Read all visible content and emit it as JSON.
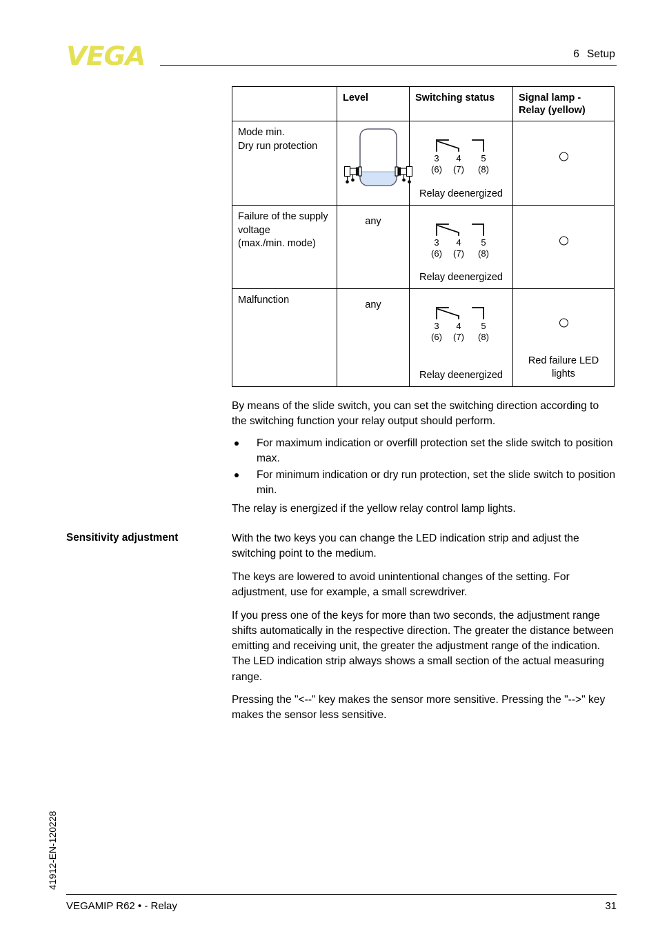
{
  "header": {
    "logo_text": "VEGA",
    "chapter_number": "6",
    "chapter_title": "Setup"
  },
  "table": {
    "columns": [
      "",
      "Level",
      "Switching status",
      "Signal lamp - Relay (yellow)"
    ],
    "rows": [
      {
        "condition_line1": "Mode min.",
        "condition_line2": "Dry run protection",
        "level": "",
        "level_graphic": "tank-low-level",
        "terminals_top": [
          "3",
          "4",
          "5"
        ],
        "terminals_bottom": [
          "(6)",
          "(7)",
          "(8)"
        ],
        "relay_state": "Relay deenergized",
        "lamp": "lamp-off-circle",
        "lamp_note": ""
      },
      {
        "condition_line1": "Failure of the supply",
        "condition_line2": "voltage",
        "condition_line3": "(max./min. mode)",
        "level": "any",
        "terminals_top": [
          "3",
          "4",
          "5"
        ],
        "terminals_bottom": [
          "(6)",
          "(7)",
          "(8)"
        ],
        "relay_state": "Relay deenergized",
        "lamp": "lamp-off-circle",
        "lamp_note": ""
      },
      {
        "condition_line1": "Malfunction",
        "level": "any",
        "terminals_top": [
          "3",
          "4",
          "5"
        ],
        "terminals_bottom": [
          "(6)",
          "(7)",
          "(8)"
        ],
        "relay_state": "Relay deenergized",
        "lamp": "lamp-off-circle",
        "lamp_note_line1": "Red failure LED",
        "lamp_note_line2": "lights"
      }
    ]
  },
  "body": {
    "intro": "By means of the slide switch, you can set the switching direction according to the switching function your relay output should perform.",
    "bullets": [
      "For maximum indication or overfill protection set the slide switch to position max.",
      "For minimum indication or dry run protection, set the slide switch to position min."
    ],
    "energized_note": "The relay is energized if the yellow relay control lamp lights.",
    "sensitivity_heading": "Sensitivity adjustment",
    "sensitivity_p1": "With the two keys you can change the LED indication strip and adjust the switching point to the medium.",
    "sensitivity_p2": "The keys are lowered to avoid unintentional changes of the setting. For adjustment, use for example, a small screwdriver.",
    "sensitivity_p3": "If you press one of the keys for more than two seconds, the adjustment range shifts automatically in the respective direction. The greater the distance between emitting and receiving unit, the greater the adjustment range of the indication. The LED indication strip always shows a small section of the actual measuring range.",
    "sensitivity_p4": "Pressing the \"<--\" key makes the sensor more sensitive.  Pressing the \"-->\" key makes the sensor less sensitive."
  },
  "footer": {
    "document_title": "VEGAMIP R62 • - Relay",
    "page_number": "31",
    "document_id": "41912-EN-120228"
  },
  "colors": {
    "logo_yellow": "#E4E053",
    "liquid_blue": "#D3E2F7",
    "rule_black": "#000000"
  }
}
